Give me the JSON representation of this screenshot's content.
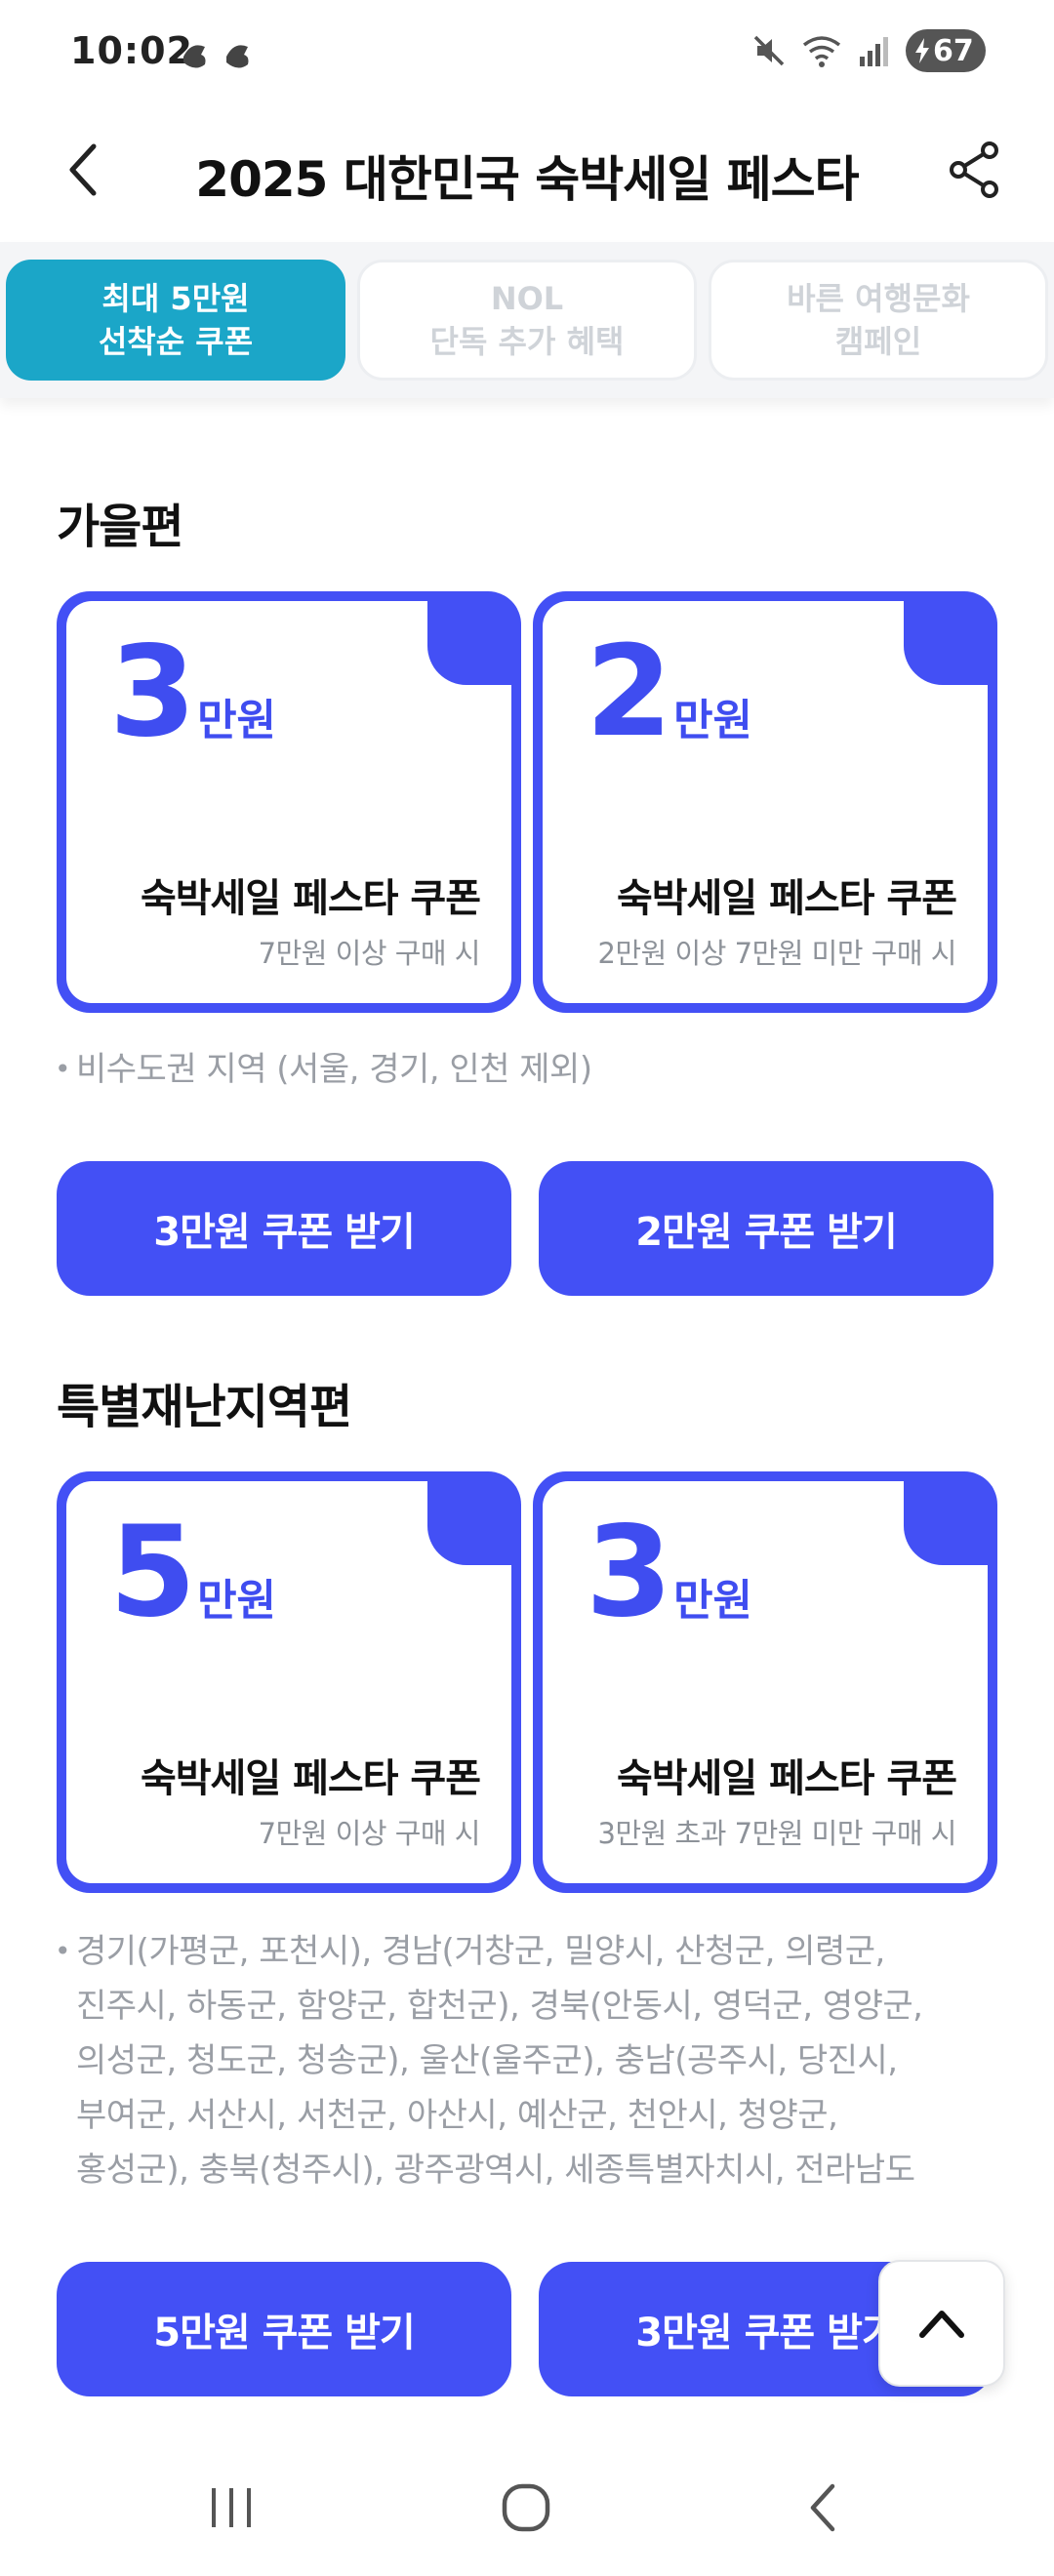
{
  "status_bar": {
    "time": "10:02",
    "battery": "67"
  },
  "header": {
    "title": "2025 대한민국 숙박세일 페스타"
  },
  "tabs": [
    {
      "line1": "최대 5만원",
      "line2": "선착순 쿠폰"
    },
    {
      "line1": "NOL",
      "line2": "단독 추가 혜택"
    },
    {
      "line1": "바른 여행문화",
      "line2": "캠페인"
    }
  ],
  "autumn": {
    "title": "가을편",
    "cards": [
      {
        "amount": "3",
        "unit": "만원",
        "title": "숙박세일 페스타 쿠폰",
        "condition": "7만원 이상 구매 시"
      },
      {
        "amount": "2",
        "unit": "만원",
        "title": "숙박세일 페스타 쿠폰",
        "condition": "2만원 이상 7만원 미만 구매 시"
      }
    ],
    "note": "비수도권 지역 (서울, 경기, 인천 제외)",
    "buttons": [
      "3만원 쿠폰 받기",
      "2만원 쿠폰 받기"
    ]
  },
  "disaster": {
    "title": "특별재난지역편",
    "cards": [
      {
        "amount": "5",
        "unit": "만원",
        "title": "숙박세일 페스타 쿠폰",
        "condition": "7만원 이상 구매 시"
      },
      {
        "amount": "3",
        "unit": "만원",
        "title": "숙박세일 페스타 쿠폰",
        "condition": "3만원 초과 7만원 미만 구매 시"
      }
    ],
    "note_lines": [
      "경기(가평군, 포천시), 경남(거창군, 밀양시, 산청군, 의령군,",
      "진주시, 하동군, 함양군, 합천군), 경북(안동시, 영덕군, 영양군,",
      "의성군, 청도군, 청송군), 울산(울주군), 충남(공주시, 당진시,",
      "부여군, 서산시, 서천군, 아산시, 예산군, 천안시, 청양군,",
      "홍성군), 충북(청주시), 광주광역시, 세종특별자치시, 전라남도"
    ],
    "buttons": [
      "5만원 쿠폰 받기",
      "3만원 쿠폰 받기"
    ]
  },
  "colors": {
    "accent": "#4350f5",
    "tab_active": "#1ba6c8",
    "note_text": "#9a9ea5"
  },
  "icons": [
    "back-arrow-icon",
    "share-icon",
    "chevron-up-icon",
    "recent-apps-icon",
    "home-icon",
    "nav-back-icon",
    "mute-icon",
    "wifi-icon",
    "signal-icon",
    "bolt-icon"
  ]
}
